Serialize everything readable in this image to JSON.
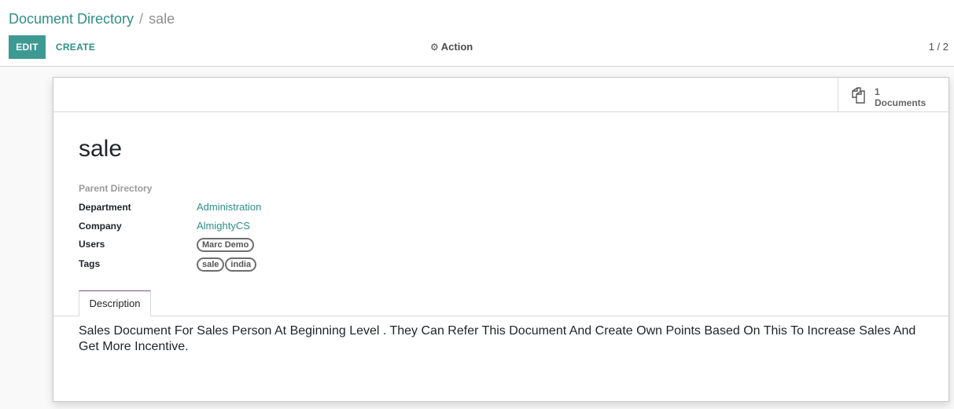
{
  "breadcrumb": {
    "parent": "Document Directory",
    "separator": "/",
    "current": "sale"
  },
  "toolbar": {
    "edit_label": "EDIT",
    "create_label": "CREATE",
    "action_label": "Action",
    "pager": "1 / 2"
  },
  "stat_button": {
    "icon": "documents-icon",
    "value": "1",
    "label": "Documents"
  },
  "record": {
    "title": "sale",
    "fields": {
      "parent_directory_label": "Parent Directory",
      "department_label": "Department",
      "department_value": "Administration",
      "company_label": "Company",
      "company_value": "AlmightyCS",
      "users_label": "Users",
      "users": [
        "Marc Demo"
      ],
      "tags_label": "Tags",
      "tags": [
        "sale",
        "india"
      ]
    }
  },
  "tabs": [
    {
      "label": "Description",
      "active": true
    }
  ],
  "description": "Sales Document For Sales Person At Beginning Level . They Can Refer This Document And Create Own Points Based On This To Increase Sales And Get More Incentive.",
  "colors": {
    "accent": "#2f8f87",
    "primary_button": "#3d9a92",
    "active_tab_border": "#7a4f83"
  }
}
